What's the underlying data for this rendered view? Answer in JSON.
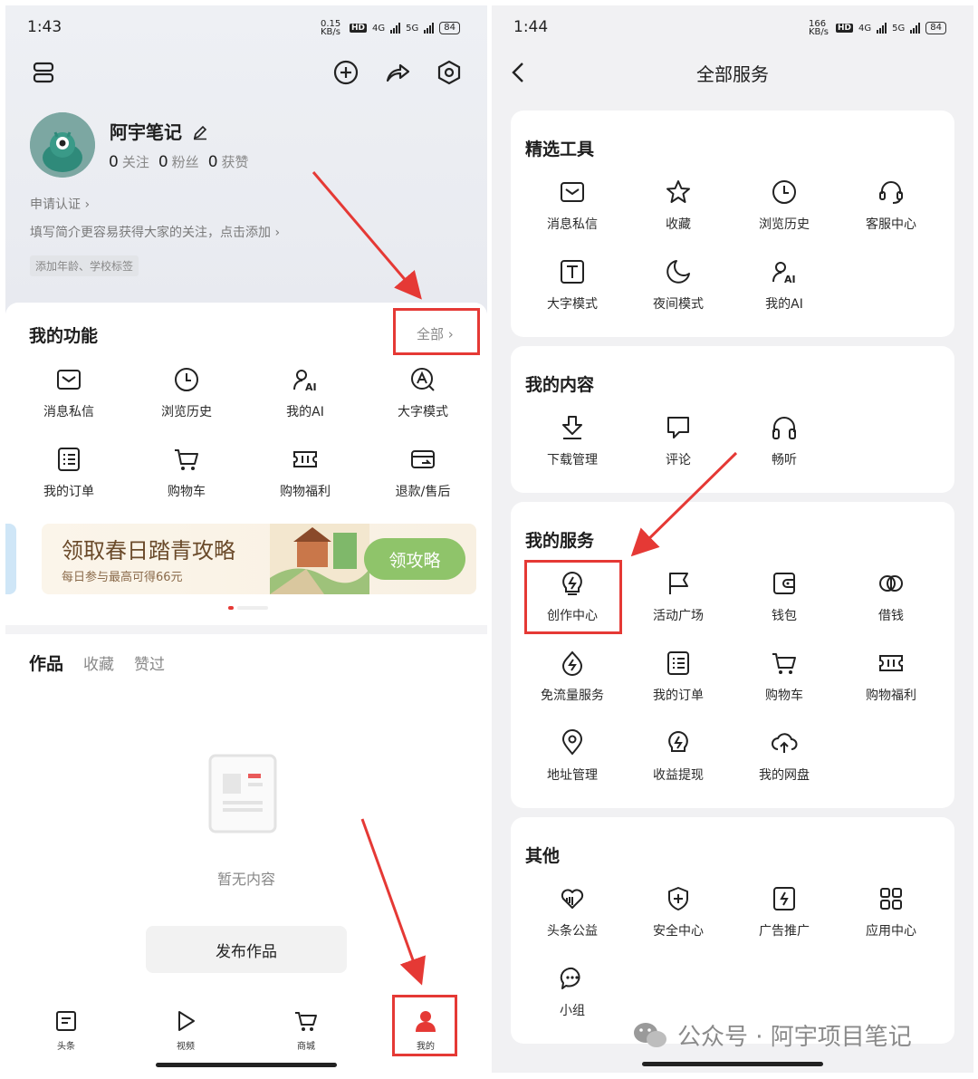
{
  "left": {
    "status": {
      "time": "1:43",
      "speed": "0.15 KB/s",
      "network1": "4G",
      "network2": "5G",
      "hd": "HD",
      "battery": "84"
    },
    "profile": {
      "name": "阿宇笔记",
      "following_count": "0",
      "following_label": "关注",
      "fans_count": "0",
      "fans_label": "粉丝",
      "likes_count": "0",
      "likes_label": "获赞"
    },
    "verify_link": "申请认证 ›",
    "bio_prompt": "填写简介更容易获得大家的关注，点击添加 ›",
    "tag_prompt": "添加年龄、学校标签",
    "functions": {
      "title": "我的功能",
      "all_label": "全部 ›",
      "items": [
        {
          "label": "消息私信",
          "icon": "envelope-icon"
        },
        {
          "label": "浏览历史",
          "icon": "clock-icon"
        },
        {
          "label": "我的AI",
          "icon": "ai-person-icon"
        },
        {
          "label": "大字模式",
          "icon": "large-text-icon"
        },
        {
          "label": "我的订单",
          "icon": "order-list-icon"
        },
        {
          "label": "购物车",
          "icon": "cart-icon"
        },
        {
          "label": "购物福利",
          "icon": "coupon-icon"
        },
        {
          "label": "退款/售后",
          "icon": "refund-card-icon"
        }
      ]
    },
    "banner": {
      "title": "领取春日踏青攻略",
      "subtitle": "每日参与最高可得66元",
      "button": "领攻略"
    },
    "tabs": [
      "作品",
      "收藏",
      "赞过"
    ],
    "empty_text": "暂无内容",
    "publish_button": "发布作品",
    "bottom_nav": [
      {
        "label": "头条",
        "icon": "news-icon"
      },
      {
        "label": "视频",
        "icon": "play-icon"
      },
      {
        "label": "商城",
        "icon": "cart-icon"
      },
      {
        "label": "我的",
        "icon": "person-icon"
      }
    ],
    "accent": "#e53935"
  },
  "right": {
    "status": {
      "time": "1:44",
      "speed": "166 KB/s",
      "network1": "4G",
      "network2": "5G",
      "hd": "HD",
      "battery": "84"
    },
    "title": "全部服务",
    "sections": [
      {
        "title": "精选工具",
        "items": [
          {
            "label": "消息私信",
            "icon": "envelope-icon"
          },
          {
            "label": "收藏",
            "icon": "star-icon"
          },
          {
            "label": "浏览历史",
            "icon": "clock-icon"
          },
          {
            "label": "客服中心",
            "icon": "headset-icon"
          },
          {
            "label": "大字模式",
            "icon": "text-t-icon"
          },
          {
            "label": "夜间模式",
            "icon": "moon-icon"
          },
          {
            "label": "我的AI",
            "icon": "ai-person-icon"
          }
        ]
      },
      {
        "title": "我的内容",
        "items": [
          {
            "label": "下载管理",
            "icon": "download-icon"
          },
          {
            "label": "评论",
            "icon": "comment-icon"
          },
          {
            "label": "畅听",
            "icon": "headphones-icon"
          }
        ]
      },
      {
        "title": "我的服务",
        "items": [
          {
            "label": "创作中心",
            "icon": "lightning-bulb-icon"
          },
          {
            "label": "活动广场",
            "icon": "flag-icon"
          },
          {
            "label": "钱包",
            "icon": "wallet-icon"
          },
          {
            "label": "借钱",
            "icon": "coins-icon"
          },
          {
            "label": "免流量服务",
            "icon": "data-drop-icon"
          },
          {
            "label": "我的订单",
            "icon": "order-list-icon"
          },
          {
            "label": "购物车",
            "icon": "cart-icon"
          },
          {
            "label": "购物福利",
            "icon": "coupon-icon"
          },
          {
            "label": "地址管理",
            "icon": "location-pin-icon"
          },
          {
            "label": "收益提现",
            "icon": "income-icon"
          },
          {
            "label": "我的网盘",
            "icon": "cloud-upload-icon"
          }
        ]
      },
      {
        "title": "其他",
        "items": [
          {
            "label": "头条公益",
            "icon": "charity-heart-icon"
          },
          {
            "label": "安全中心",
            "icon": "shield-plus-icon"
          },
          {
            "label": "广告推广",
            "icon": "ad-lightning-icon"
          },
          {
            "label": "应用中心",
            "icon": "apps-grid-icon"
          },
          {
            "label": "小组",
            "icon": "chat-bubble-icon"
          }
        ]
      }
    ],
    "watermark": "公众号 · 阿宇项目笔记"
  }
}
